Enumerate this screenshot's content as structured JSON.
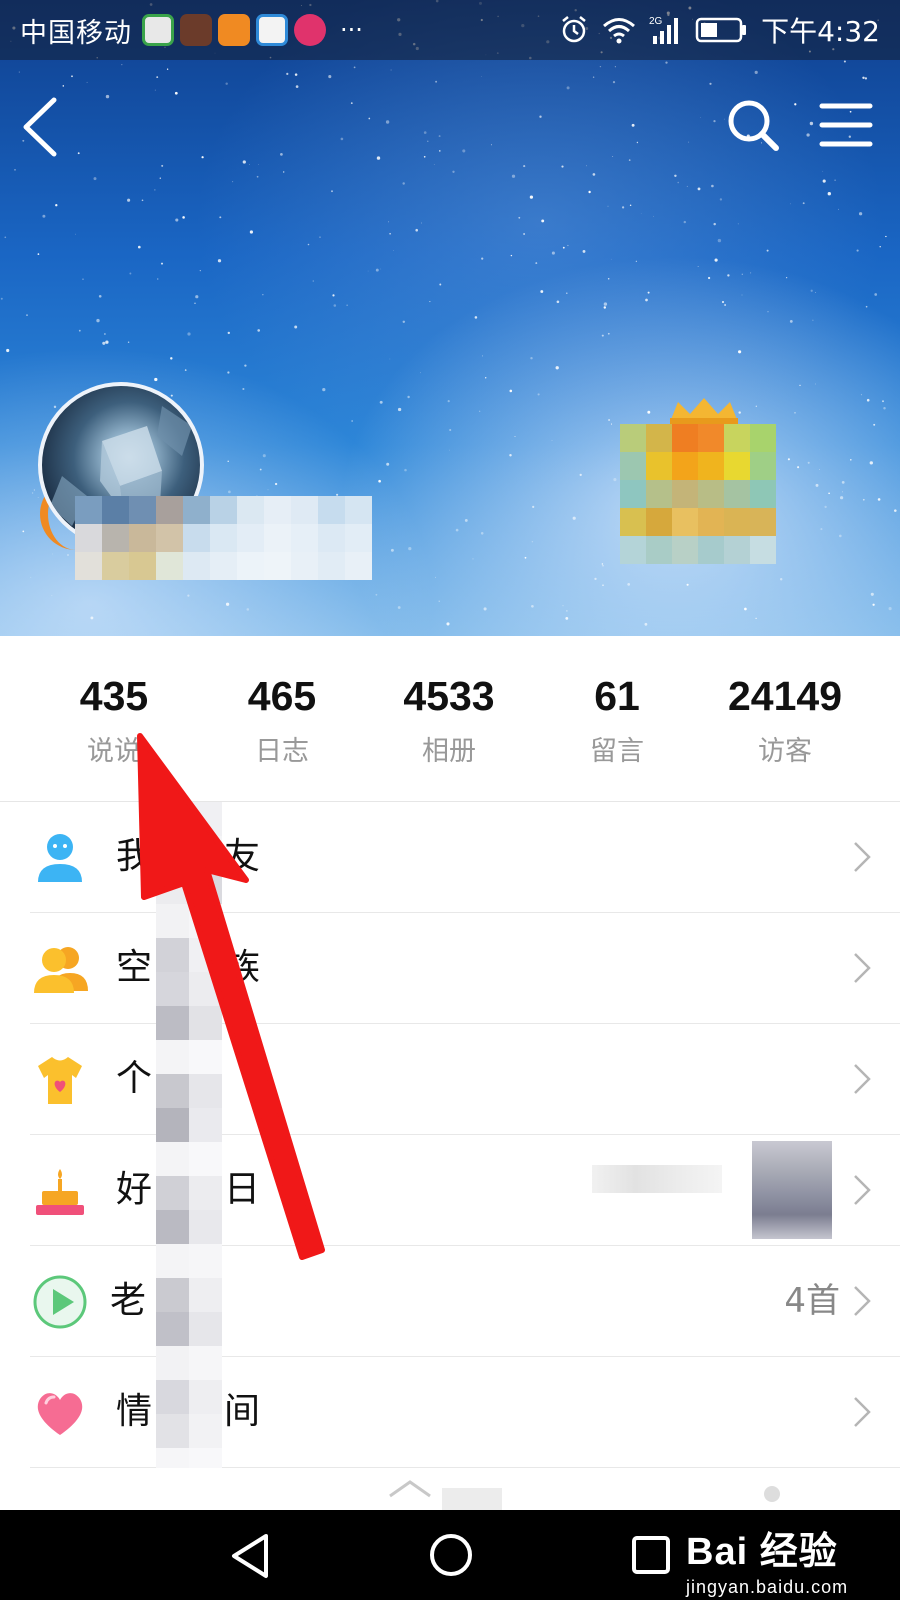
{
  "status_bar": {
    "carrier": "中国移动",
    "dots": "···",
    "network": "2G",
    "time": "下午4:32"
  },
  "nav": {
    "back_icon": "chevron-left-icon",
    "search_icon": "search-icon",
    "menu_icon": "hamburger-menu-icon"
  },
  "stats": [
    {
      "value": "435",
      "label": "说说"
    },
    {
      "value": "465",
      "label": "日志"
    },
    {
      "value": "4533",
      "label": "相册"
    },
    {
      "value": "61",
      "label": "留言"
    },
    {
      "value": "24149",
      "label": "访客"
    }
  ],
  "menu": [
    {
      "label": "我　　友",
      "icon": "friend-person-icon",
      "extra": ""
    },
    {
      "label": "空　　族",
      "icon": "family-group-icon",
      "extra": ""
    },
    {
      "label": "个　　",
      "icon": "tshirt-icon",
      "extra": ""
    },
    {
      "label": "好　　日",
      "icon": "birthday-cake-icon",
      "extra": ""
    },
    {
      "label": "老　　",
      "icon": "play-circle-icon",
      "extra": "4首"
    },
    {
      "label": "情　　间",
      "icon": "heart-icon",
      "extra": ""
    }
  ],
  "watermark": {
    "main": "Bai 经验",
    "sub": "jingyan.baidu.com"
  },
  "colors": {
    "arrow": "#f01818",
    "stat_label": "#999999",
    "accent_orange": "#f08a22"
  }
}
